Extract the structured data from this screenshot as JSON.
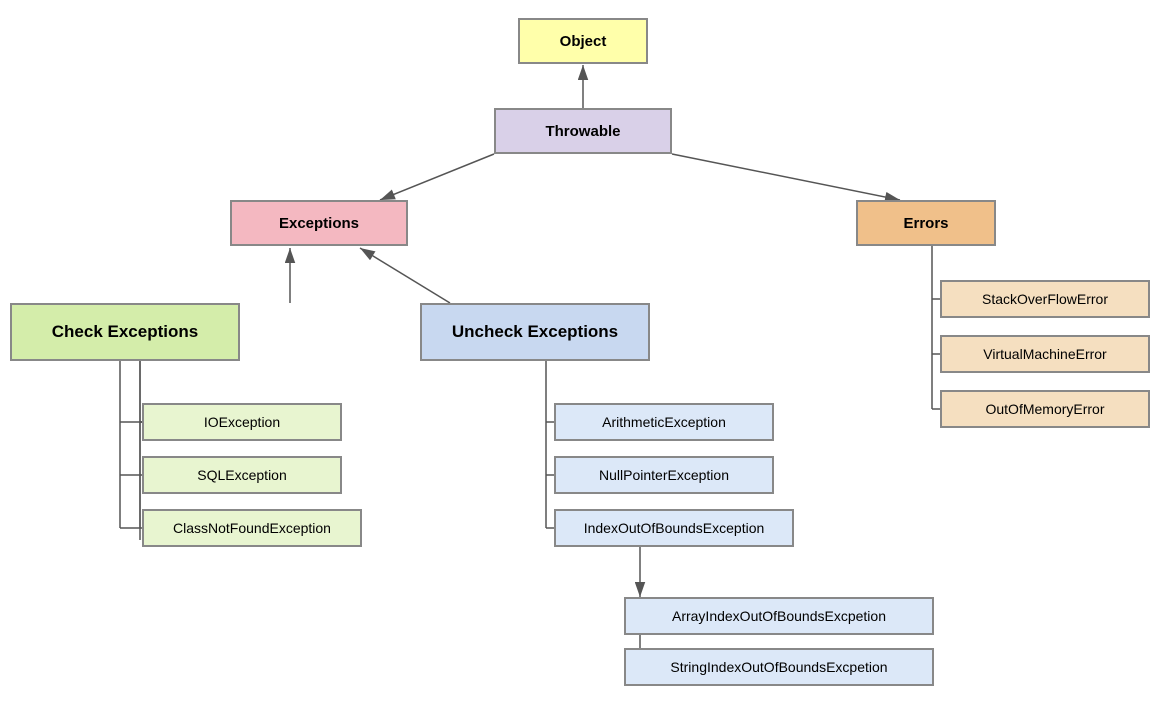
{
  "nodes": {
    "object": {
      "label": "Object"
    },
    "throwable": {
      "label": "Throwable"
    },
    "exceptions": {
      "label": "Exceptions"
    },
    "errors": {
      "label": "Errors"
    },
    "check": {
      "label": "Check Exceptions"
    },
    "uncheck": {
      "label": "Uncheck Exceptions"
    },
    "ioexception": {
      "label": "IOException"
    },
    "sqlexception": {
      "label": "SQLException"
    },
    "classnotfound": {
      "label": "ClassNotFoundException"
    },
    "arithmetic": {
      "label": "ArithmeticException"
    },
    "nullpointer": {
      "label": "NullPointerException"
    },
    "indexoutofbounds": {
      "label": "IndexOutOfBoundsException"
    },
    "arrayindex": {
      "label": "ArrayIndexOutOfBoundsExcpetion"
    },
    "stringindex": {
      "label": "StringIndexOutOfBoundsExcpetion"
    },
    "stackoverflow": {
      "label": "StackOverFlowError"
    },
    "virtualmachine": {
      "label": "VirtualMachineError"
    },
    "outofmemory": {
      "label": "OutOfMemoryError"
    }
  }
}
